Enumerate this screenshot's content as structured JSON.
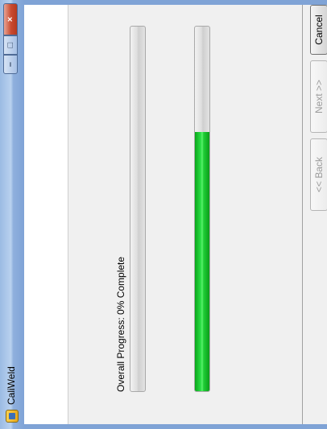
{
  "window": {
    "title": "CaliWeld",
    "minimize_label": "–",
    "maximize_label": "□",
    "close_label": "×"
  },
  "progress": {
    "overall_label": "Overall Progress: 0% Complete",
    "overall_percent": 0,
    "current_percent": 0.71
  },
  "buttons": {
    "back_label": "<< Back",
    "next_label": "Next >>",
    "cancel_label": "Cancel"
  },
  "colors": {
    "title_bar": "#9bbbe3",
    "progress_fill": "#2adf45"
  }
}
